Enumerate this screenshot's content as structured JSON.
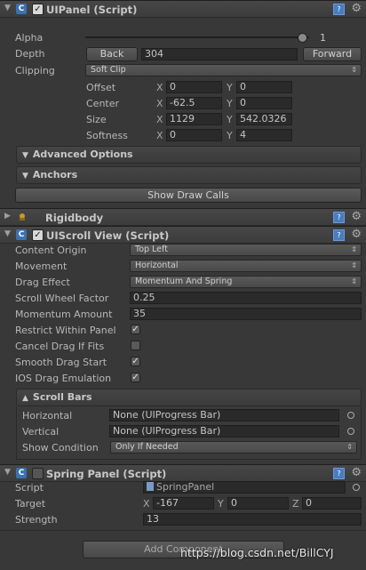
{
  "uipanel": {
    "title": "UIPanel (Script)",
    "alpha_label": "Alpha",
    "alpha_value": "1",
    "alpha_fraction": 0.97,
    "depth_label": "Depth",
    "back_button": "Back",
    "depth_value": "304",
    "forward_button": "Forward",
    "clipping_label": "Clipping",
    "clipping_value": "Soft Clip",
    "offset_label": "Offset",
    "offset_x": "0",
    "offset_y": "0",
    "center_label": "Center",
    "center_x": "-62.5",
    "center_y": "0",
    "size_label": "Size",
    "size_x": "1129",
    "size_y": "542.0326",
    "softness_label": "Softness",
    "softness_x": "0",
    "softness_y": "4",
    "advanced_options": "Advanced Options",
    "anchors": "Anchors",
    "show_draw_calls": "Show Draw Calls"
  },
  "axis_labels": {
    "x": "X",
    "y": "Y",
    "z": "Z"
  },
  "rigidbody": {
    "title": "Rigidbody"
  },
  "uiscrollview": {
    "title": "UIScroll View (Script)",
    "content_origin_label": "Content Origin",
    "content_origin_value": "Top Left",
    "movement_label": "Movement",
    "movement_value": "Horizontal",
    "drag_effect_label": "Drag Effect",
    "drag_effect_value": "Momentum And Spring",
    "scroll_wheel_label": "Scroll Wheel Factor",
    "scroll_wheel_value": "0.25",
    "momentum_label": "Momentum Amount",
    "momentum_value": "35",
    "restrict_label": "Restrict Within Panel",
    "restrict_checked": true,
    "cancel_drag_label": "Cancel Drag If Fits",
    "cancel_drag_checked": false,
    "smooth_drag_label": "Smooth Drag Start",
    "smooth_drag_checked": true,
    "ios_drag_label": "IOS Drag Emulation",
    "ios_drag_checked": true,
    "scroll_bars_title": "Scroll Bars",
    "horizontal_label": "Horizontal",
    "horizontal_value": "None (UIProgress Bar)",
    "vertical_label": "Vertical",
    "vertical_value": "None (UIProgress Bar)",
    "show_condition_label": "Show Condition",
    "show_condition_value": "Only If Needed"
  },
  "springpanel": {
    "title": "Spring Panel (Script)",
    "script_label": "Script",
    "script_value": "SpringPanel",
    "target_label": "Target",
    "target_x": "-167",
    "target_y": "0",
    "target_z": "0",
    "strength_label": "Strength",
    "strength_value": "13"
  },
  "add_component": "Add Component",
  "watermark": "https://blog.csdn.net/BillCYJ",
  "icons": {
    "checkmark": "✓",
    "gear": "⚙",
    "help": "?",
    "fold_down": "▼",
    "fold_right": "▶",
    "fold_up": "▲",
    "dropdown_arrows": "⇕",
    "script_c": "C"
  }
}
